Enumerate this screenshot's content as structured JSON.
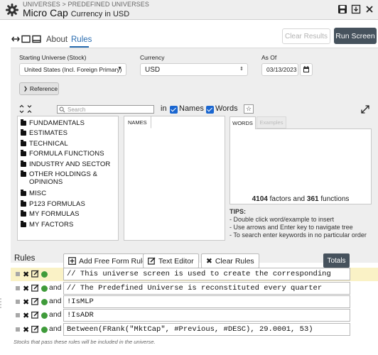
{
  "header": {
    "breadcrumb": "UNIVERSES > PREDEFINED UNIVERSES",
    "title": "Micro Cap",
    "subtitle": "Currency in USD"
  },
  "toolbar": {
    "tab_about": "About",
    "tab_rules": "Rules",
    "clear_results_label": "Clear Results",
    "run_screen_label": "Run Screen"
  },
  "settings": {
    "starting_universe_label": "Starting Universe (Stock)",
    "starting_universe_value": "United States (Incl. Foreign Primary)",
    "currency_label": "Currency",
    "currency_value": "USD",
    "as_of_label": "As Of",
    "as_of_value": "03/13/2023",
    "reference_label": "Reference"
  },
  "reference": {
    "search_placeholder": "Search",
    "in_label": "in",
    "names_label": "Names",
    "words_label": "Words",
    "tree_items": [
      "FUNDAMENTALS",
      "ESTIMATES",
      "TECHNICAL",
      "FORMULA FUNCTIONS",
      "INDUSTRY AND SECTOR",
      "OTHER HOLDINGS &",
      "OPINIONS",
      "MISC",
      "P123 FORMULAS",
      "MY FORMULAS",
      "MY FACTORS"
    ],
    "names_tab": "NAMES",
    "words_tab": "WORDS",
    "examples_tab": "Examples",
    "factor_count": "4104",
    "factor_count_text": "factors and",
    "function_count": "361",
    "function_count_text": "functions",
    "tips_heading": "TIPS:",
    "tips": [
      "- Double click word/example to insert",
      "- Use arrows and Enter key to navigate tree",
      "- To search enter keywords in no particular order"
    ]
  },
  "rules": {
    "heading": "Rules",
    "add_free_form_label": "Add Free Form Rule",
    "text_editor_label": "Text Editor",
    "clear_rules_label": "Clear Rules",
    "totals_label": "Totals",
    "and_label": "and",
    "items": [
      "// This universe screen is used to create the corresponding",
      "// The Predefined Universe is reconstituted every quarter",
      "!IsMLP",
      "!IsADR",
      "Between(FRank(\"MktCap\", #Previous, #DESC), 29.0001, 53)"
    ],
    "footer_note": "Stocks that pass these rules will be included in the universe."
  },
  "colors": {
    "accent": "#2a6db0",
    "dark_button": "#46525d",
    "rule_highlight": "#faf2c6",
    "status_green": "#3f9b3a",
    "checkbox_blue": "#1a66d0"
  }
}
